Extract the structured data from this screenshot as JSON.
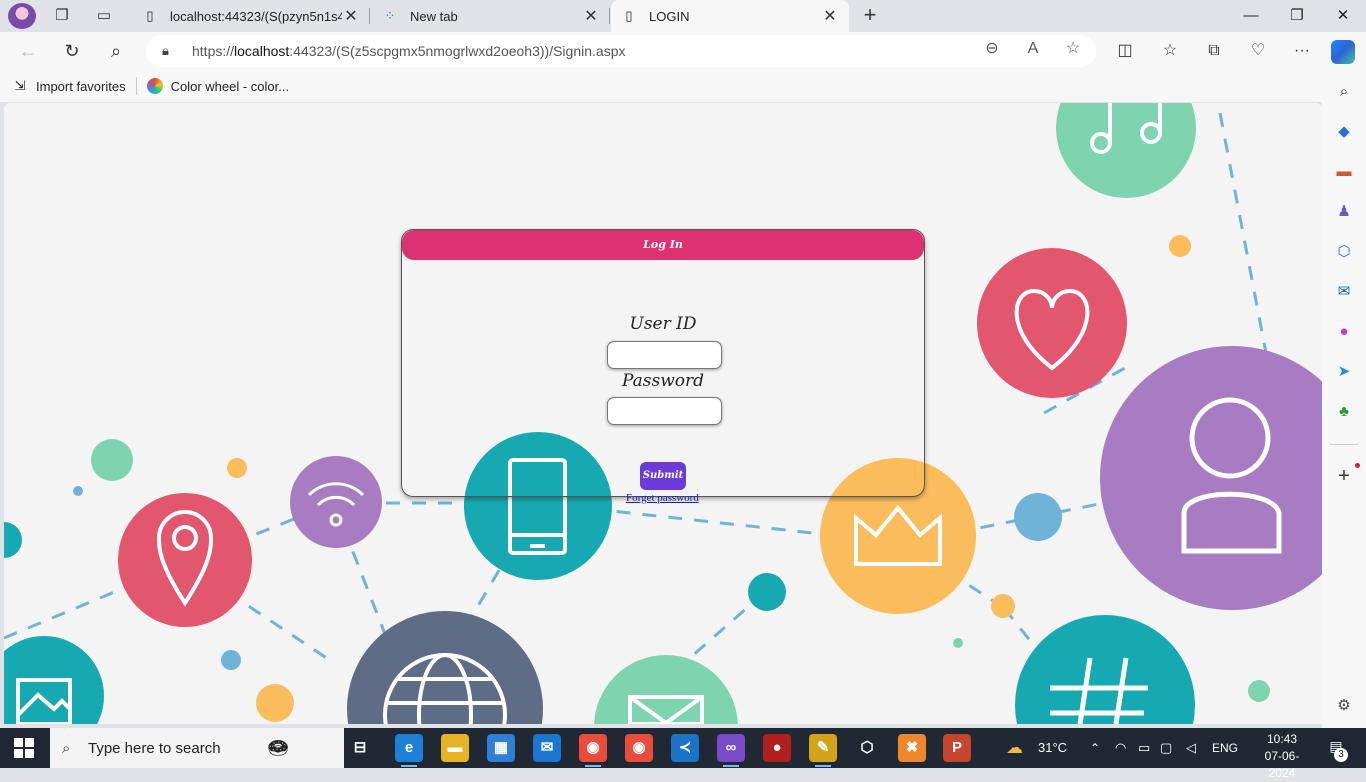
{
  "browser": {
    "tabs": [
      {
        "label": "localhost:44323/(S(pzyn5n1s4vio",
        "icon": "page-icon",
        "state": "inactive"
      },
      {
        "label": "New tab",
        "icon": "edge-newtab-icon",
        "state": "inactive"
      },
      {
        "label": "LOGIN",
        "icon": "page-icon",
        "state": "active"
      }
    ],
    "address": {
      "prefix": "https://",
      "host": "localhost",
      "rest": ":44323/(S(z5scpgmx5nmogrlwxd2oeoh3))/Signin.aspx"
    },
    "favorites": [
      {
        "label": "Import favorites",
        "icon": "import-icon"
      },
      {
        "label": "Color wheel - color...",
        "icon": "color-wheel-icon"
      }
    ]
  },
  "page": {
    "header_title": "Log In",
    "userid_label": "User ID",
    "userid_value": "",
    "password_label": "Password",
    "password_value": "",
    "submit_label": "Submit",
    "forget_link": "Forget password"
  },
  "taskbar": {
    "search_placeholder": "Type here to search",
    "weather": "31°C",
    "language": "ENG",
    "time": "10:43",
    "date": "07-06-2024",
    "notification_count": "3"
  },
  "colors": {
    "header": "#dc3272",
    "submit": "#6b3ad8",
    "taskbar": "#1f2833"
  }
}
